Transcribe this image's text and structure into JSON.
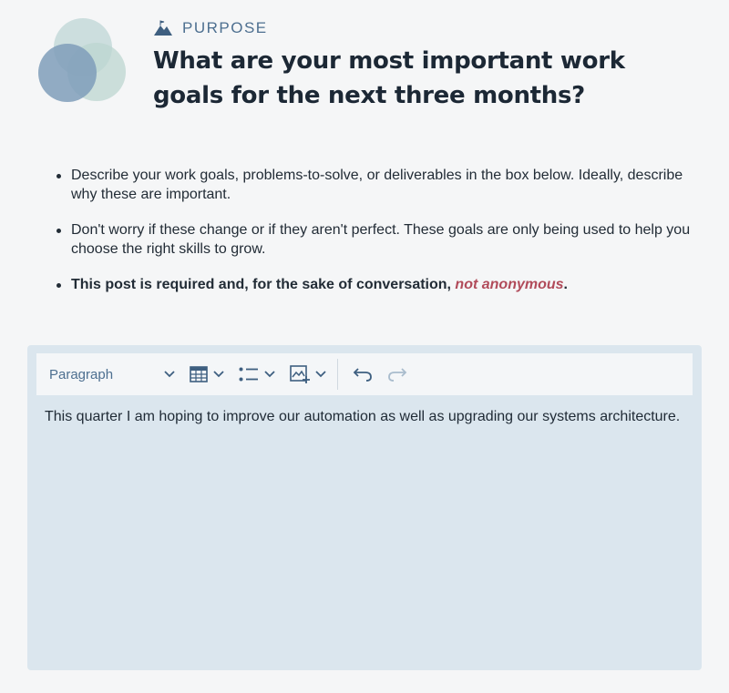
{
  "header": {
    "kicker": "PURPOSE",
    "title": "What are your most important work goals for the next three months?"
  },
  "instructions": {
    "items": [
      "Describe your work goals, problems-to-solve, or deliverables in the box below. Ideally, describe why these are important.",
      "Don't worry if these change or if they aren't perfect. These goals are only being used to help you choose the right skills to grow."
    ],
    "required_prefix": "This post is required and, for the sake of conversation, ",
    "required_highlight": "not anonymous",
    "required_suffix": "."
  },
  "editor": {
    "toolbar": {
      "block_style": "Paragraph",
      "icons": [
        "table-icon",
        "bulleted-list-icon",
        "insert-image-icon",
        "undo-icon",
        "redo-icon"
      ]
    },
    "content": "This quarter I am hoping to improve our automation as well as upgrading our systems architecture."
  },
  "colors": {
    "accent": "#4d6f90",
    "highlight": "#b14b5a",
    "editor_bg": "#dbe6ee",
    "page_bg": "#f5f6f7"
  }
}
